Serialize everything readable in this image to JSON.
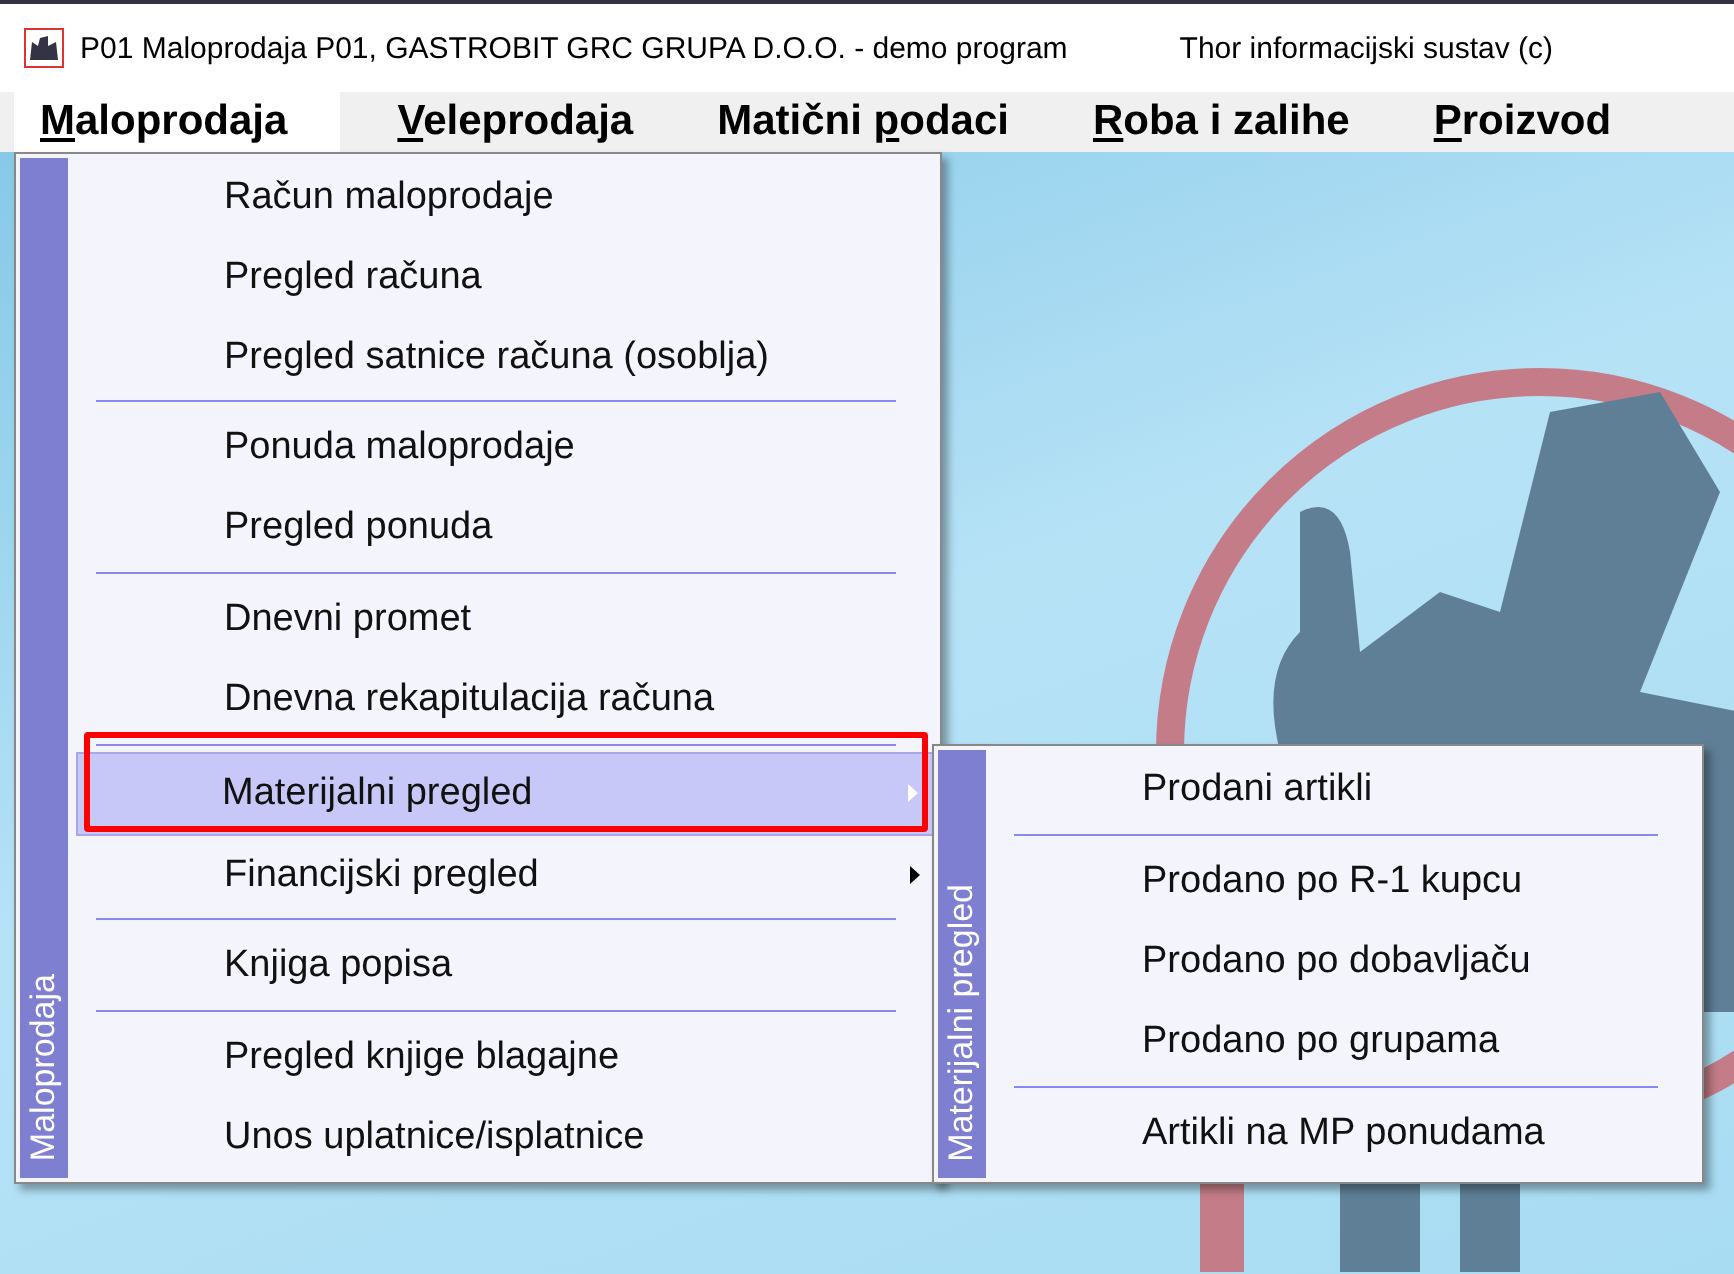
{
  "window": {
    "title": "P01 Maloprodaja P01, GASTROBIT GRC GRUPA D.O.O. - demo program",
    "title_right": "Thor informacijski sustav (c)"
  },
  "menubar": [
    {
      "key": "M",
      "after": "aloprodaja",
      "selected": true
    },
    {
      "key": "V",
      "after": "eleprodaja",
      "selected": false
    },
    {
      "before": "Matični ",
      "key": "p",
      "after": "odaci",
      "selected": false
    },
    {
      "key": "R",
      "after": "oba i zalihe",
      "selected": false
    },
    {
      "key": "P",
      "after": "roizvod",
      "selected": false
    }
  ],
  "menu": {
    "side_label": "Maloprodaja",
    "items": [
      {
        "kind": "item",
        "label": "Račun maloprodaje",
        "selected": false,
        "submenu": false
      },
      {
        "kind": "item",
        "label": "Pregled računa",
        "selected": false,
        "submenu": false
      },
      {
        "kind": "item",
        "label": "Pregled satnice računa (osoblja)",
        "selected": false,
        "submenu": false
      },
      {
        "kind": "separator"
      },
      {
        "kind": "item",
        "label": "Ponuda maloprodaje",
        "selected": false,
        "submenu": false
      },
      {
        "kind": "item",
        "label": "Pregled ponuda",
        "selected": false,
        "submenu": false
      },
      {
        "kind": "separator"
      },
      {
        "kind": "item",
        "label": "Dnevni promet",
        "selected": false,
        "submenu": false
      },
      {
        "kind": "item",
        "label": "Dnevna rekapitulacija računa",
        "selected": false,
        "submenu": false
      },
      {
        "kind": "separator"
      },
      {
        "kind": "item",
        "label": "Materijalni pregled",
        "selected": true,
        "submenu": true
      },
      {
        "kind": "item",
        "label": "Financijski pregled",
        "selected": false,
        "submenu": true
      },
      {
        "kind": "separator"
      },
      {
        "kind": "item",
        "label": "Knjiga popisa",
        "selected": false,
        "submenu": false
      },
      {
        "kind": "separator"
      },
      {
        "kind": "item",
        "label": "Pregled knjige blagajne",
        "selected": false,
        "submenu": false
      },
      {
        "kind": "item",
        "label": "Unos uplatnice/isplatnice",
        "selected": false,
        "submenu": false
      }
    ]
  },
  "submenu": {
    "side_label": "Materijalni pregled",
    "items": [
      {
        "kind": "item",
        "label": "Prodani artikli",
        "selected": false,
        "submenu": false
      },
      {
        "kind": "separator"
      },
      {
        "kind": "item",
        "label": "Prodano po R-1 kupcu",
        "selected": false,
        "submenu": false
      },
      {
        "kind": "item",
        "label": "Prodano po dobavljaču",
        "selected": false,
        "submenu": false
      },
      {
        "kind": "item",
        "label": "Prodano po grupama",
        "selected": false,
        "submenu": false
      },
      {
        "kind": "separator"
      },
      {
        "kind": "item",
        "label": "Artikli na MP ponudama",
        "selected": false,
        "submenu": false
      }
    ]
  }
}
